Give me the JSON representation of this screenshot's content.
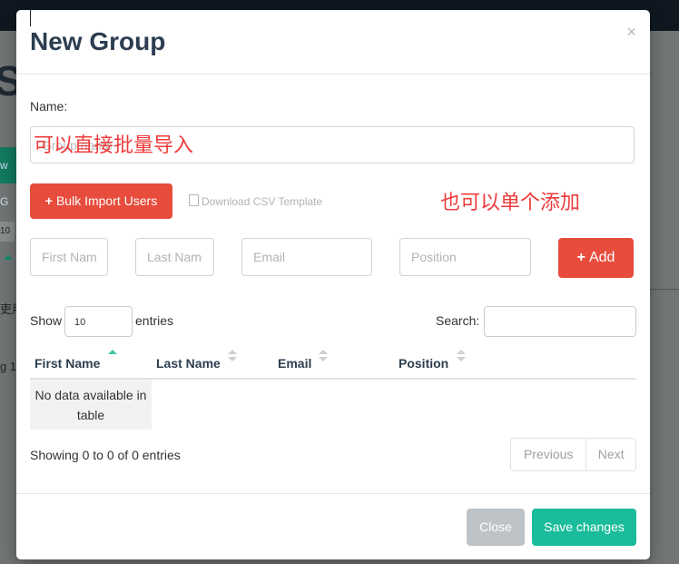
{
  "background": {
    "big_letter": "S",
    "green_btn_text": "w G",
    "select_value": "10",
    "text_1": "吏用",
    "text_2": "g 1"
  },
  "modal": {
    "title": "New Group",
    "close_glyph": "×",
    "name_label": "Name:",
    "name_placeholder": "Group name",
    "bulk_import_label": "Bulk Import Users",
    "download_template_label": "Download CSV Template",
    "annotation_bulk": "可以直接批量导入",
    "annotation_single": "也可以单个添加",
    "fields": {
      "first_name_placeholder": "First Name",
      "last_name_placeholder": "Last Name",
      "email_placeholder": "Email",
      "position_placeholder": "Position"
    },
    "add_label": "Add",
    "plus_glyph": "+",
    "table": {
      "show_label": "Show",
      "page_length": "10",
      "entries_label": "entries",
      "search_label": "Search:",
      "columns": [
        "First Name",
        "Last Name",
        "Email",
        "Position"
      ],
      "empty_message": "No data available in table",
      "info": "Showing 0 to 0 of 0 entries",
      "prev_label": "Previous",
      "next_label": "Next"
    },
    "close_label": "Close",
    "save_label": "Save changes"
  },
  "colors": {
    "primary_red": "#e74c3c",
    "success": "#1abc9c",
    "annotation": "#ef3b3b",
    "title": "#2c3e50"
  },
  "icons": [
    "plus-icon",
    "file-icon",
    "sort-icon",
    "close-icon"
  ]
}
